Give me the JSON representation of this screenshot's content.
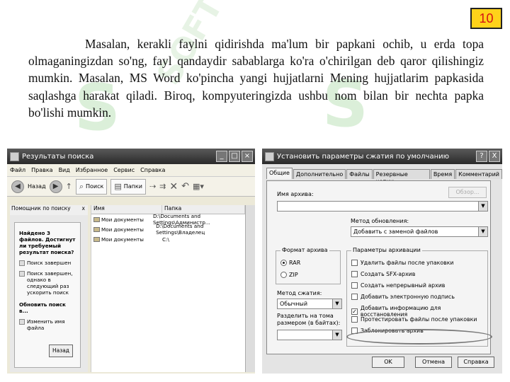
{
  "slide": {
    "number": "10",
    "paragraph": "Masalan, kerakli faylni qidirishda ma'lum bir papkani ochib, u erda topa olmaganingizdan so'ng, fayl qandaydir sabablarga ko'ra o'chirilgan deb qaror qilishingiz mumkin. Masalan, MS Word ko'pincha yangi hujjatlarni Mening hujjatlarim papkasida saqlashga harakat qiladi. Biroq, kompyuteringizda ushbu nom bilan bir nechta papka bo'lishi mumkin.",
    "watermark": "SOFT"
  },
  "search_window": {
    "title": "Результаты поиска",
    "menu": [
      "Файл",
      "Правка",
      "Вид",
      "Избранное",
      "Сервис",
      "Справка"
    ],
    "toolbar": {
      "back": "Назад",
      "search": "Поиск",
      "folders": "Папки"
    },
    "left_pane": {
      "title": "Помощник по поиску",
      "close": "x",
      "heading": "Найдено 3 файлов. Достигнут ли требуемый результат поиска?",
      "options": [
        "Поиск завершен",
        "Поиск завершен, однако в следующий раз ускорить поиск"
      ],
      "refine_heading": "Обновить поиск в...",
      "refine_option": "Изменить имя файла",
      "back_button": "Назад"
    },
    "columns": [
      "Имя",
      "Папка"
    ],
    "rows": [
      {
        "name": "Мои документы",
        "folder": "D:\\Documents and Settings\\Администр..."
      },
      {
        "name": "Мои документы",
        "folder": "D:\\Documents and Settings\\Владелец"
      },
      {
        "name": "Мои документы",
        "folder": "C:\\"
      }
    ]
  },
  "archive_window": {
    "title": "Установить параметры сжатия по умолчанию",
    "help": "?",
    "close": "X",
    "tabs": [
      "Общие",
      "Дополнительно",
      "Файлы",
      "Резервные копии",
      "Время",
      "Комментарий"
    ],
    "archive_name_label": "Имя архива:",
    "browse_button": "Обзор...",
    "update_method_label": "Метод обновления:",
    "update_method_value": "Добавить с заменой файлов",
    "format_group": "Формат архива",
    "formats": [
      "RAR",
      "ZIP"
    ],
    "selected_format": "RAR",
    "method_label": "Метод сжатия:",
    "method_value": "Обычный",
    "split_label": "Разделить на тома размером (в байтах):",
    "options_group": "Параметры архивации",
    "options": [
      {
        "label": "Удалить файлы после упаковки",
        "checked": false
      },
      {
        "label": "Создать SFX-архив",
        "checked": false
      },
      {
        "label": "Создать непрерывный архив",
        "checked": false
      },
      {
        "label": "Добавить электронную подпись",
        "checked": false
      },
      {
        "label": "Добавить информацию для восстановления",
        "checked": true
      },
      {
        "label": "Протестировать файлы после упаковки",
        "checked": false
      },
      {
        "label": "Заблокировать архив",
        "checked": false
      }
    ],
    "buttons": {
      "ok": "OK",
      "cancel": "Отмена",
      "help": "Справка"
    }
  }
}
